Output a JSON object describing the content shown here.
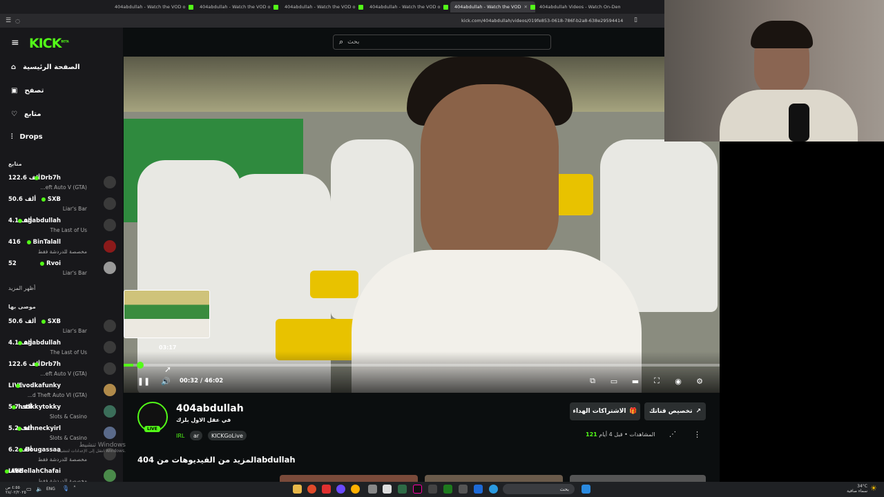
{
  "browser": {
    "tabs": [
      {
        "label": "404abdullah - Watch the VOD o",
        "active": false
      },
      {
        "label": "404abdullah - Watch the VOD o",
        "active": false
      },
      {
        "label": "404abdullah - Watch the VOD o",
        "active": false
      },
      {
        "label": "404abdullah - Watch the VOD o",
        "active": false
      },
      {
        "label": "404abdullah - Watch the VOD",
        "active": true
      },
      {
        "label": "404abdullah Videos - Watch On-Dem",
        "active": false
      }
    ],
    "url": "kick.com/404abdullah/videos/019fe853-0618-786f-b2a8-638e29594414"
  },
  "header": {
    "logo": "KICK",
    "logo_sup": "BETA",
    "search_placeholder": "بحث"
  },
  "sidebar": {
    "nav": [
      {
        "label": "الصفحة الرئيسية",
        "icon": "home-icon"
      },
      {
        "label": "تصفح",
        "icon": "browse-icon"
      },
      {
        "label": "متابع",
        "icon": "heart-icon"
      },
      {
        "label": "Drops",
        "icon": "drops-icon"
      }
    ],
    "following_title": "متابع",
    "following": [
      {
        "name": "Drb7h",
        "viewers": "122.6 ألف",
        "category": "...eft Auto V (GTA)"
      },
      {
        "name": "SXB",
        "viewers": "50.6 ألف",
        "category": "Liar's Bar"
      },
      {
        "name": "ogabdullah",
        "viewers": "4.1 ألف",
        "category": "The Last of Us"
      },
      {
        "name": "BinTalall",
        "viewers": "416",
        "category": "مخصصة للدردشة فقط"
      },
      {
        "name": "Rvoi",
        "viewers": "52",
        "category": "Liar's Bar"
      }
    ],
    "show_more": "أظهر المزيد",
    "recommended_title": "موصى بها",
    "recommended": [
      {
        "name": "SXB",
        "viewers": "50.6 ألف",
        "category": "Liar's Bar"
      },
      {
        "name": "ogabdullah",
        "viewers": "4.1 ألف",
        "category": "The Last of Us"
      },
      {
        "name": "Drb7h",
        "viewers": "122.6 ألف",
        "category": "...eft Auto V (GTA)"
      },
      {
        "name": "vodkafunky",
        "viewers": "LIVE",
        "category": "...d Theft Auto VI (GTA)"
      },
      {
        "name": "hstikkytokky",
        "viewers": "5.7 ألف",
        "category": "Slots & Casino"
      },
      {
        "name": "schneckyirl",
        "viewers": "5.2 ألف",
        "category": "Slots & Casino"
      },
      {
        "name": "Bougassaa",
        "viewers": "6.2 ألف",
        "category": "مخصصة للدردشة فقط"
      },
      {
        "name": "AbdellahChafai",
        "viewers": "LIVE",
        "category": "مخصصة للدردشة فقط"
      }
    ]
  },
  "player": {
    "preview_time": "03:17",
    "current_time": "00:32",
    "separator": "/",
    "duration": "46:02",
    "progress_fraction": 0.016,
    "hover_fraction": 0.072
  },
  "video": {
    "channel": "404abdullah",
    "live_badge": "LIVE",
    "title": "في عقل الاول بلزك",
    "tags": [
      "IRL",
      "ar",
      "KICKGoLive"
    ],
    "views_label": "المشاهدات",
    "views": "121",
    "age": "قبل 4 أيام",
    "gift_button": "الاشتراكات الهداء",
    "clip_button": "تخصيص قناتك",
    "more_videos": "المزيد من الفيديوهات من 404abdullah"
  },
  "watermark": {
    "line1": "تنشيط Windows",
    "line2": "انتقل إلى الإعدادات لتنشيط Windows."
  },
  "taskbar": {
    "lang": "ENG",
    "time": "٤:٥٥ ص",
    "date": "٢٨/٠٢/٢٠٢٥",
    "weather": "34°C",
    "weather_desc": "سماء صافية",
    "search": "بحث"
  },
  "colors": {
    "accent": "#53fc18",
    "bg": "#0b0e0f",
    "sidebar": "#18181b"
  }
}
